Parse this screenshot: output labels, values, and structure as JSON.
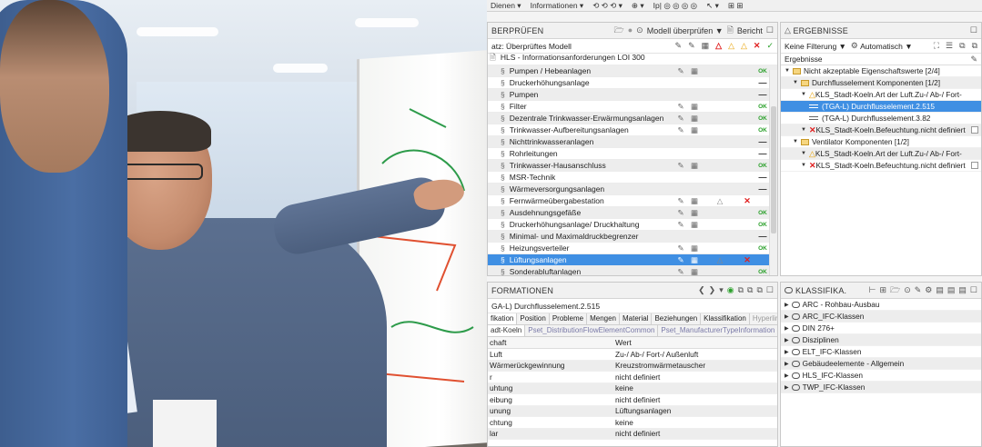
{
  "toolbar_top": {
    "items": [
      "Dienen ▾",
      "Informationen ▾",
      "⟲ ⟲ ⟲ ▾",
      "⊕ ▾",
      "Ip| ◎ ◎ ◎ ◎",
      "↖ ▾",
      "⊞ ⊞"
    ]
  },
  "check_pane": {
    "title": "BERPRÜFEN",
    "check_model_label": "Modell überprüfen ▼",
    "report_label": "Bericht",
    "set_label": "atz: Überprüftes Modell",
    "root_label": "HLS - Informationsanforderungen LOI 300",
    "ok": "OK",
    "rows": [
      {
        "label": "Pumpen / Hebeanlagen",
        "c1": "✎",
        "c2": "▦",
        "c3": "",
        "c4": "",
        "status": "OK",
        "alt": true
      },
      {
        "label": "Druckerhöhungsanlage",
        "c1": "",
        "c2": "",
        "c3": "",
        "c4": "",
        "status": "—",
        "alt": false
      },
      {
        "label": "Pumpen",
        "c1": "",
        "c2": "",
        "c3": "",
        "c4": "",
        "status": "—",
        "alt": true
      },
      {
        "label": "Filter",
        "c1": "✎",
        "c2": "▦",
        "c3": "",
        "c4": "",
        "status": "OK",
        "alt": false
      },
      {
        "label": "Dezentrale Trinkwasser-Erwärmungsanlagen",
        "c1": "✎",
        "c2": "▦",
        "c3": "",
        "c4": "",
        "status": "OK",
        "alt": true
      },
      {
        "label": "Trinkwasser-Aufbereitungsanlagen",
        "c1": "✎",
        "c2": "▦",
        "c3": "",
        "c4": "",
        "status": "OK",
        "alt": false
      },
      {
        "label": "Nichttrinkwasseranlagen",
        "c1": "",
        "c2": "",
        "c3": "",
        "c4": "",
        "status": "—",
        "alt": true
      },
      {
        "label": "Rohrleitungen",
        "c1": "",
        "c2": "",
        "c3": "",
        "c4": "",
        "status": "—",
        "alt": false
      },
      {
        "label": "Trinkwasser-Hausanschluss",
        "c1": "✎",
        "c2": "▦",
        "c3": "",
        "c4": "",
        "status": "OK",
        "alt": true
      },
      {
        "label": "MSR-Technik",
        "c1": "",
        "c2": "",
        "c3": "",
        "c4": "",
        "status": "—",
        "alt": false
      },
      {
        "label": "Wärmeversorgungsanlagen",
        "c1": "",
        "c2": "",
        "c3": "",
        "c4": "",
        "status": "—",
        "alt": true
      },
      {
        "label": "Fernwärmeübergabestation",
        "c1": "✎",
        "c2": "▦",
        "c3": "△",
        "c4": "✕",
        "status": "",
        "alt": false
      },
      {
        "label": "Ausdehnungsgefäße",
        "c1": "✎",
        "c2": "▦",
        "c3": "",
        "c4": "",
        "status": "OK",
        "alt": true
      },
      {
        "label": "Druckerhöhungsanlage/ Druckhaltung",
        "c1": "✎",
        "c2": "▦",
        "c3": "",
        "c4": "",
        "status": "OK",
        "alt": false
      },
      {
        "label": "Minimal- und Maximaldruckbegrenzer",
        "c1": "",
        "c2": "",
        "c3": "",
        "c4": "",
        "status": "—",
        "alt": true
      },
      {
        "label": "Heizungsverteiler",
        "c1": "✎",
        "c2": "▦",
        "c3": "",
        "c4": "",
        "status": "OK",
        "alt": false
      },
      {
        "label": "Lüftungsanlagen",
        "c1": "✎",
        "c2": "▦",
        "c3": "△",
        "c4": "✕",
        "status": "",
        "alt": false,
        "selected": true
      },
      {
        "label": "Sonderabluftanlagen",
        "c1": "✎",
        "c2": "▦",
        "c3": "",
        "c4": "",
        "status": "OK",
        "alt": true
      }
    ]
  },
  "info_pane": {
    "title": "FORMATIONEN",
    "element_name": "GA-L) Durchflusselement.2.515",
    "tabs": [
      "fikation",
      "Position",
      "Probleme",
      "Mengen",
      "Material",
      "Beziehungen",
      "Klassifikation",
      "Hyperlinks"
    ],
    "subtabs": [
      "adt-Koeln",
      "Pset_DistributionFlowElementCommon",
      "Pset_ManufacturerTypeInformation"
    ],
    "col_property": "chaft",
    "col_value": "Wert",
    "rows": [
      {
        "k": "Luft",
        "v": "Zu-/ Ab-/ Fort-/ Außenluft"
      },
      {
        "k": "Wärmerückgewinnung",
        "v": "Kreuzstromwärmetauscher"
      },
      {
        "k": "r",
        "v": "nicht definiert"
      },
      {
        "k": "uhtung",
        "v": "keine"
      },
      {
        "k": "eibung",
        "v": "nicht definiert"
      },
      {
        "k": "unung",
        "v": "Lüftungsanlagen"
      },
      {
        "k": "chtung",
        "v": "keine"
      },
      {
        "k": "lar",
        "v": "nicht definiert"
      }
    ]
  },
  "results_pane": {
    "title": "ERGEBNISSE",
    "filter_label": "Keine Filterung ▼",
    "auto_label": "Automatisch ▼",
    "col_label": "Ergebnisse",
    "rows": [
      {
        "indent": 0,
        "icon": "folder",
        "label": "Nicht akzeptable Eigenschaftswerte [2/4]",
        "alt": false
      },
      {
        "indent": 1,
        "icon": "folder",
        "label": "Durchflusselement Komponenten [1/2]",
        "alt": true
      },
      {
        "indent": 2,
        "icon": "warn",
        "label": "KLS_Stadt-Koeln.Art der Luft.Zu-/ Ab-/ Fort-",
        "alt": false
      },
      {
        "indent": 3,
        "icon": "elem",
        "label": "(TGA-L) Durchflusselement.2.515",
        "alt": false,
        "selected": true
      },
      {
        "indent": 3,
        "icon": "elem",
        "label": "(TGA-L) Durchflusselement.3.82",
        "alt": false
      },
      {
        "indent": 2,
        "icon": "err",
        "label": "KLS_Stadt-Koeln.Befeuchtung.nicht definiert",
        "alt": true
      },
      {
        "indent": 1,
        "icon": "folder",
        "label": "Ventilator Komponenten [1/2]",
        "alt": false
      },
      {
        "indent": 2,
        "icon": "warn",
        "label": "KLS_Stadt-Koeln.Art der Luft.Zu-/ Ab-/ Fort-",
        "alt": true
      },
      {
        "indent": 2,
        "icon": "err",
        "label": "KLS_Stadt-Koeln.Befeuchtung.nicht definiert",
        "alt": false
      }
    ]
  },
  "class_pane": {
    "title": "KLASSIFIKA.",
    "rows": [
      {
        "label": "ARC - Rohbau-Ausbau",
        "alt": false
      },
      {
        "label": "ARC_IFC-Klassen",
        "alt": true
      },
      {
        "label": "DIN 276+",
        "alt": false
      },
      {
        "label": "Disziplinen",
        "alt": true
      },
      {
        "label": "ELT_IFC-Klassen",
        "alt": false
      },
      {
        "label": "Gebäudeelemente - Allgemein",
        "alt": true
      },
      {
        "label": "HLS_IFC-Klassen",
        "alt": false
      },
      {
        "label": "TWP_IFC-Klassen",
        "alt": true
      }
    ]
  }
}
